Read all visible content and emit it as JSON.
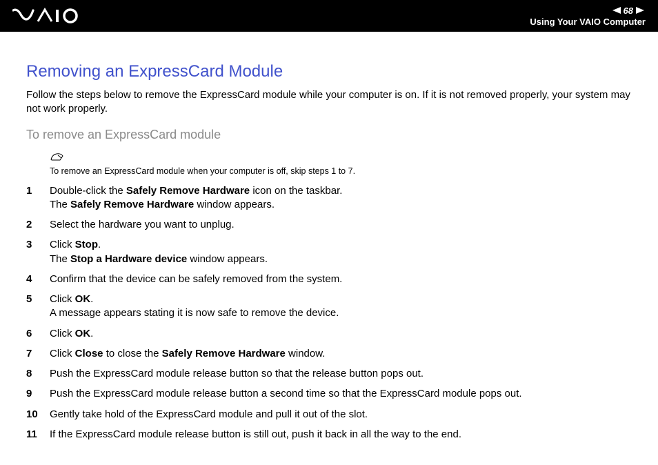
{
  "header": {
    "page_number": "68",
    "section_title": "Using Your VAIO Computer"
  },
  "content": {
    "title": "Removing an ExpressCard Module",
    "intro": "Follow the steps below to remove the ExpressCard module while your computer is on. If it is not removed properly, your system may not work properly.",
    "subtitle": "To remove an ExpressCard module",
    "note": "To remove an ExpressCard module when your computer is off, skip steps 1 to 7.",
    "steps": [
      {
        "num": "1",
        "parts": [
          {
            "t": "Double-click the "
          },
          {
            "t": "Safely Remove Hardware",
            "b": true
          },
          {
            "t": " icon on the taskbar."
          },
          {
            "br": true
          },
          {
            "t": "The "
          },
          {
            "t": "Safely Remove Hardware",
            "b": true
          },
          {
            "t": " window appears."
          }
        ]
      },
      {
        "num": "2",
        "parts": [
          {
            "t": "Select the hardware you want to unplug."
          }
        ]
      },
      {
        "num": "3",
        "parts": [
          {
            "t": "Click "
          },
          {
            "t": "Stop",
            "b": true
          },
          {
            "t": "."
          },
          {
            "br": true
          },
          {
            "t": "The "
          },
          {
            "t": "Stop a Hardware device",
            "b": true
          },
          {
            "t": " window appears."
          }
        ]
      },
      {
        "num": "4",
        "parts": [
          {
            "t": "Confirm that the device can be safely removed from the system."
          }
        ]
      },
      {
        "num": "5",
        "parts": [
          {
            "t": "Click "
          },
          {
            "t": "OK",
            "b": true
          },
          {
            "t": "."
          },
          {
            "br": true
          },
          {
            "t": "A message appears stating it is now safe to remove the device."
          }
        ]
      },
      {
        "num": "6",
        "parts": [
          {
            "t": "Click "
          },
          {
            "t": "OK",
            "b": true
          },
          {
            "t": "."
          }
        ]
      },
      {
        "num": "7",
        "parts": [
          {
            "t": "Click "
          },
          {
            "t": "Close",
            "b": true
          },
          {
            "t": " to close the "
          },
          {
            "t": "Safely Remove Hardware",
            "b": true
          },
          {
            "t": " window."
          }
        ]
      },
      {
        "num": "8",
        "parts": [
          {
            "t": "Push the ExpressCard module release button so that the release button pops out."
          }
        ]
      },
      {
        "num": "9",
        "parts": [
          {
            "t": "Push the ExpressCard module release button a second time so that the ExpressCard module pops out."
          }
        ]
      },
      {
        "num": "10",
        "parts": [
          {
            "t": "Gently take hold of the ExpressCard module and pull it out of the slot."
          }
        ]
      },
      {
        "num": "11",
        "parts": [
          {
            "t": "If the ExpressCard module release button is still out, push it back in all the way to the end."
          }
        ]
      }
    ]
  }
}
